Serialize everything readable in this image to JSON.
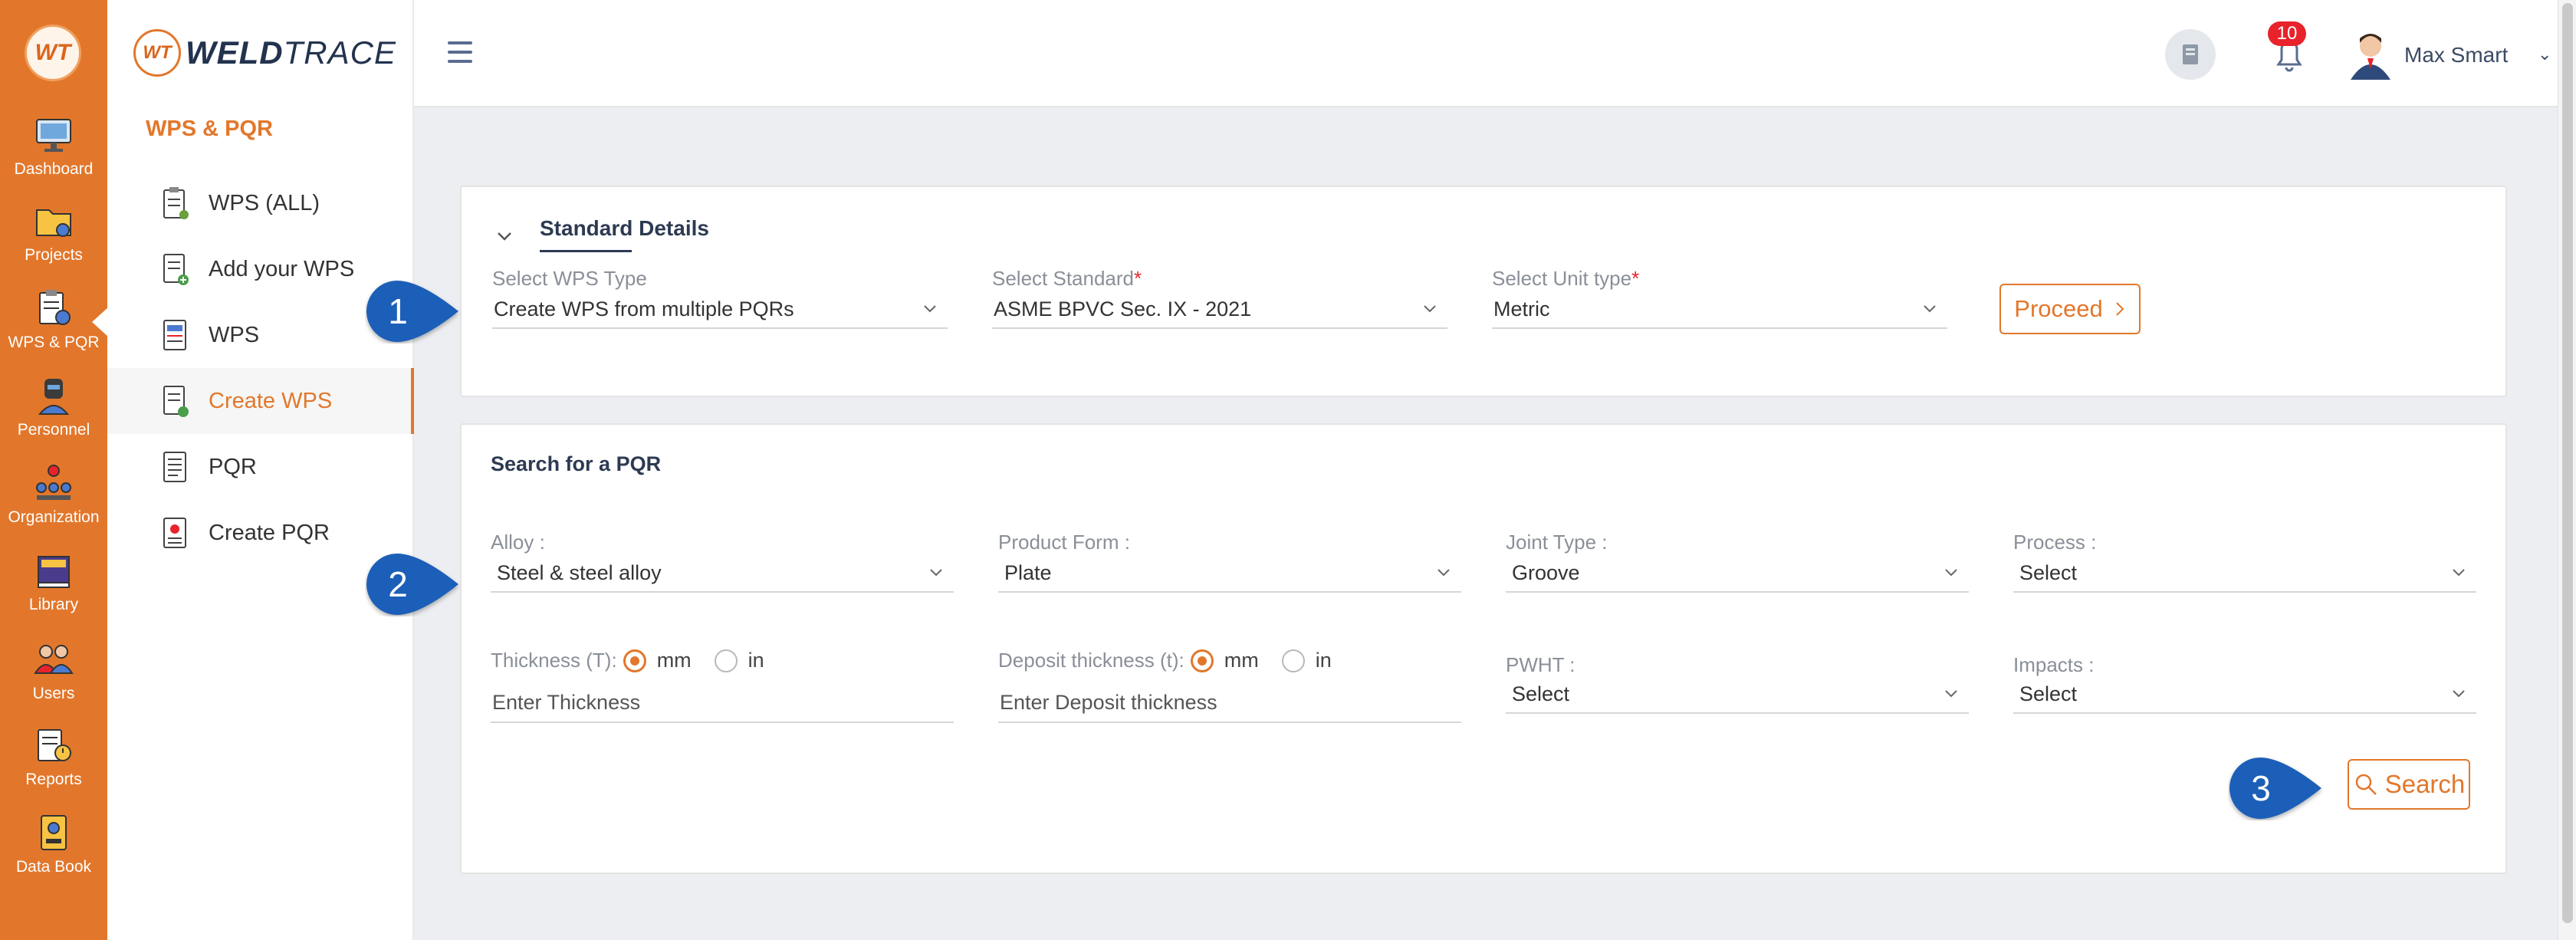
{
  "rail": {
    "logo_text": "WT",
    "items": [
      {
        "label": "Dashboard"
      },
      {
        "label": "Projects"
      },
      {
        "label": "WPS & PQR"
      },
      {
        "label": "Personnel"
      },
      {
        "label": "Organization"
      },
      {
        "label": "Library"
      },
      {
        "label": "Users"
      },
      {
        "label": "Reports"
      },
      {
        "label": "Data Book"
      }
    ]
  },
  "brand": {
    "mark": "WT",
    "weld": "WELD",
    "trace": "TRACE"
  },
  "sidebar": {
    "title": "WPS & PQR",
    "items": [
      {
        "label": "WPS (ALL)",
        "icon": "clipboard-icon"
      },
      {
        "label": "Add your WPS",
        "icon": "document-add-icon"
      },
      {
        "label": "WPS",
        "icon": "wps-icon"
      },
      {
        "label": "Create WPS",
        "icon": "create-wps-icon",
        "active": true
      },
      {
        "label": "PQR",
        "icon": "pqr-icon"
      },
      {
        "label": "Create PQR",
        "icon": "create-pqr-icon"
      }
    ]
  },
  "header": {
    "notifications": "10",
    "user_name": "Max Smart"
  },
  "standard_details": {
    "title": "Standard Details",
    "wps_type": {
      "label": "Select WPS Type",
      "value": "Create WPS from multiple PQRs"
    },
    "standard": {
      "label": "Select Standard",
      "required": "*",
      "value": "ASME BPVC Sec. IX - 2021"
    },
    "unit_type": {
      "label": "Select Unit type",
      "required": "*",
      "value": "Metric"
    },
    "proceed_label": "Proceed"
  },
  "pqr_search": {
    "title": "Search for a PQR",
    "alloy": {
      "label": "Alloy :",
      "value": "Steel & steel alloy"
    },
    "product_form": {
      "label": "Product Form :",
      "value": "Plate"
    },
    "joint_type": {
      "label": "Joint Type :",
      "value": "Groove"
    },
    "process": {
      "label": "Process :",
      "value": "Select"
    },
    "thickness": {
      "label": "Thickness (T):",
      "unit_mm": "mm",
      "unit_in": "in",
      "selected_unit": "mm",
      "placeholder": "Enter Thickness"
    },
    "deposit_thickness": {
      "label": "Deposit thickness (t):",
      "unit_mm": "mm",
      "unit_in": "in",
      "selected_unit": "mm",
      "placeholder": "Enter Deposit thickness"
    },
    "pwht": {
      "label": "PWHT :",
      "value": "Select"
    },
    "impacts": {
      "label": "Impacts :",
      "value": "Select"
    },
    "search_label": "Search"
  },
  "callouts": [
    "1",
    "2",
    "3"
  ],
  "colors": {
    "accent": "#e2772b",
    "rail": "#e2772b",
    "callout": "#1f5fb8",
    "badge": "#e8232b"
  }
}
